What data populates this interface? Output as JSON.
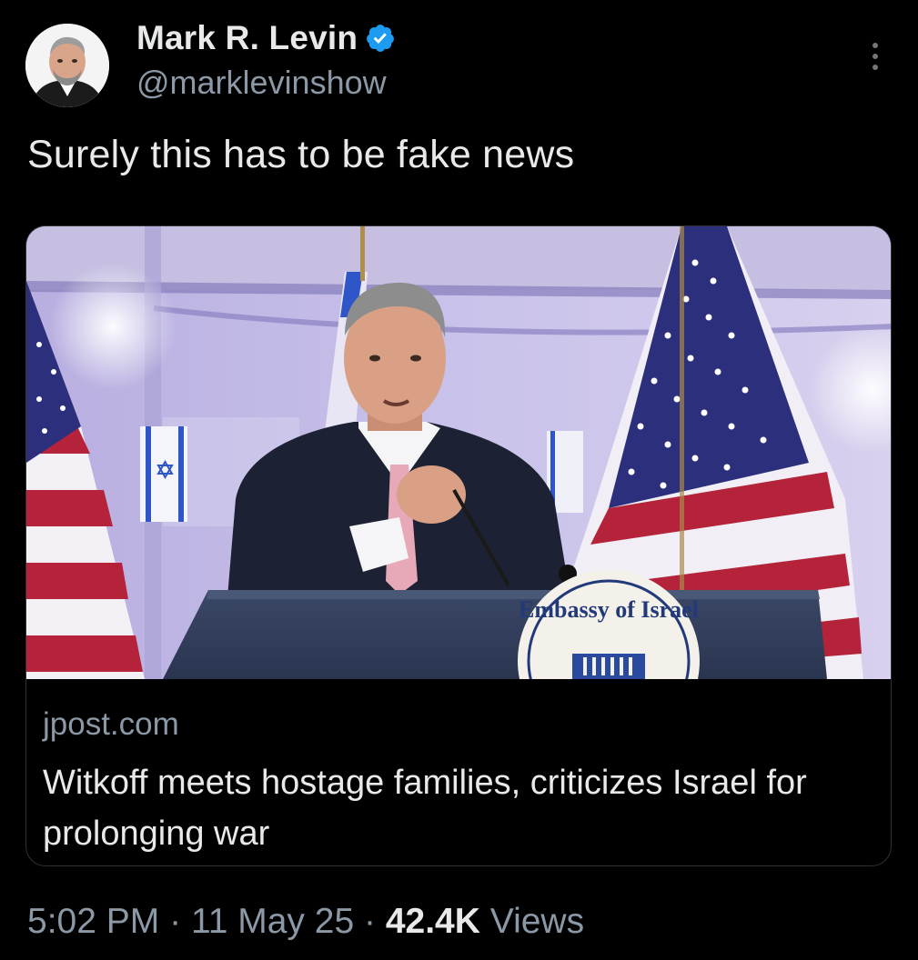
{
  "author": {
    "display_name": "Mark R. Levin",
    "handle": "@marklevinshow",
    "verified": true
  },
  "tweet": {
    "text": "Surely this has to be fake news"
  },
  "card": {
    "domain": "jpost.com",
    "title": "Witkoff meets hostage families, criticizes Israel for prolonging war",
    "image": {
      "podium_seal_text": "Embassy of Israel"
    }
  },
  "meta": {
    "time": "5:02 PM",
    "separator": "·",
    "date": "11 May 25",
    "views_count": "42.4K",
    "views_label": "Views"
  },
  "colors": {
    "background": "#000000",
    "text_primary": "#e7e9ea",
    "text_secondary": "#8b98a5",
    "verified_badge": "#1d9bf0",
    "border": "#2f3336"
  },
  "icons": {
    "verified": "verified-badge-icon",
    "more": "more-options-icon"
  }
}
